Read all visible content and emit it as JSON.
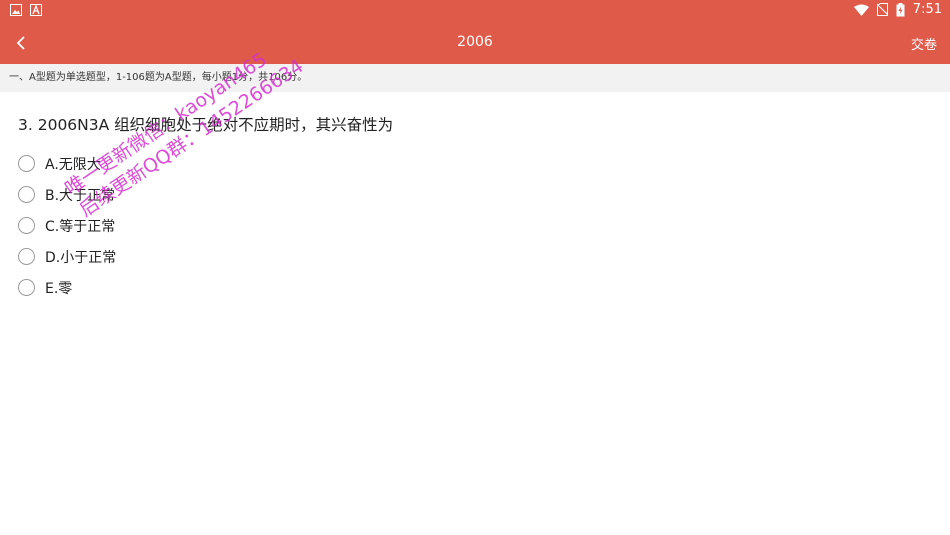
{
  "status_bar": {
    "time": "7:51",
    "left_icons": [
      "image-icon",
      "font-icon"
    ],
    "right_icons": [
      "wifi-icon",
      "no-sim-icon",
      "battery-icon"
    ]
  },
  "app_bar": {
    "title": "2006",
    "submit_label": "交卷",
    "background_color": "#e05a4a"
  },
  "section_header": {
    "text": "一、A型题为单选题型，1-106题为A型题，每小题1分，共106分。"
  },
  "question": {
    "text": "3. 2006N3A 组织细胞处于绝对不应期时，其兴奋性为",
    "options": [
      {
        "label": "A.无限大"
      },
      {
        "label": "B.大于正常"
      },
      {
        "label": "C.等于正常"
      },
      {
        "label": "D.小于正常"
      },
      {
        "label": "E.零"
      }
    ]
  },
  "watermark": {
    "line1": "唯一更新微信：kaoyan465",
    "line2": "后续更新QQ群：1452266634",
    "color": "#d52fd1"
  }
}
